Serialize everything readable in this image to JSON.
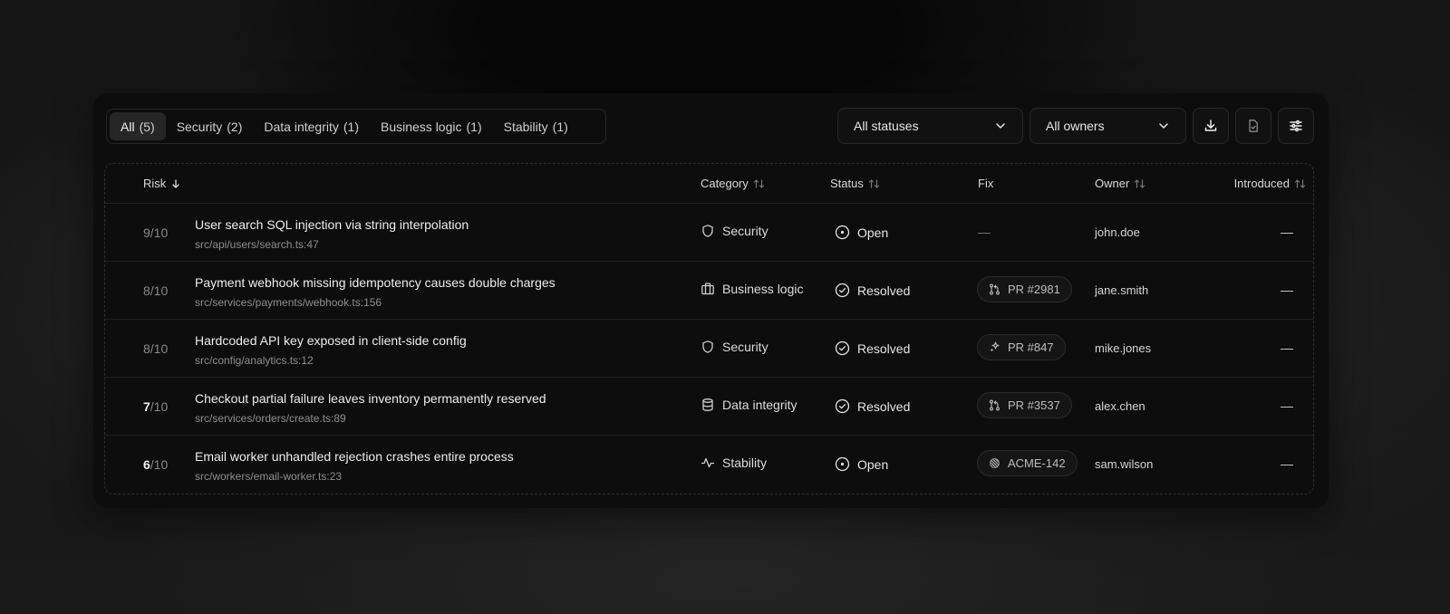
{
  "tabs": [
    {
      "label": "All",
      "count": "(5)",
      "active": true
    },
    {
      "label": "Security",
      "count": "(2)"
    },
    {
      "label": "Data integrity",
      "count": "(1)"
    },
    {
      "label": "Business logic",
      "count": "(1)"
    },
    {
      "label": "Stability",
      "count": "(1)"
    }
  ],
  "filters": {
    "status": {
      "value": "All statuses",
      "icon": "chevron-down-icon"
    },
    "owner": {
      "value": "All owners",
      "icon": "chevron-down-icon"
    }
  },
  "toolbar": {
    "download_icon": "download-icon",
    "report_icon": "file-check-icon",
    "settings_icon": "sliders-icon"
  },
  "columns": {
    "risk": "Risk",
    "category": "Category",
    "status": "Status",
    "fix": "Fix",
    "owner": "Owner",
    "introduced": "Introduced"
  },
  "rows": [
    {
      "risk": "9",
      "risk_max": "/10",
      "title": "User search SQL injection via string interpolation",
      "path": "src/api/users/search.ts:47",
      "category": "Security",
      "category_icon": "shield-icon",
      "status": "Open",
      "status_icon": "circle-dot-icon",
      "fix": "—",
      "fix_icon": "",
      "owner": "john.doe",
      "introduced": "—"
    },
    {
      "risk": "8",
      "risk_max": "/10",
      "title": "Payment webhook missing idempotency causes double charges",
      "path": "src/services/payments/webhook.ts:156",
      "category": "Business logic",
      "category_icon": "briefcase-icon",
      "status": "Resolved",
      "status_icon": "circle-check-icon",
      "fix": "PR #2981",
      "fix_icon": "git-pull-request-icon",
      "owner": "jane.smith",
      "introduced": "—"
    },
    {
      "risk": "8",
      "risk_max": "/10",
      "title": "Hardcoded API key exposed in client-side config",
      "path": "src/config/analytics.ts:12",
      "category": "Security",
      "category_icon": "shield-icon",
      "status": "Resolved",
      "status_icon": "circle-check-icon",
      "fix": "PR #847",
      "fix_icon": "sparkle-icon",
      "owner": "mike.jones",
      "introduced": "—"
    },
    {
      "risk": "7",
      "risk_max": "/10",
      "title": "Checkout partial failure leaves inventory permanently reserved",
      "path": "src/services/orders/create.ts:89",
      "category": "Data integrity",
      "category_icon": "database-icon",
      "status": "Resolved",
      "status_icon": "circle-check-icon",
      "fix": "PR #3537",
      "fix_icon": "git-pull-request-icon",
      "owner": "alex.chen",
      "introduced": "—"
    },
    {
      "risk": "6",
      "risk_max": "/10",
      "title": "Email worker unhandled rejection crashes entire process",
      "path": "src/workers/email-worker.ts:23",
      "category": "Stability",
      "category_icon": "activity-icon",
      "status": "Open",
      "status_icon": "circle-dot-icon",
      "fix": "ACME-142",
      "fix_icon": "linear-icon",
      "owner": "sam.wilson",
      "introduced": "—"
    }
  ]
}
